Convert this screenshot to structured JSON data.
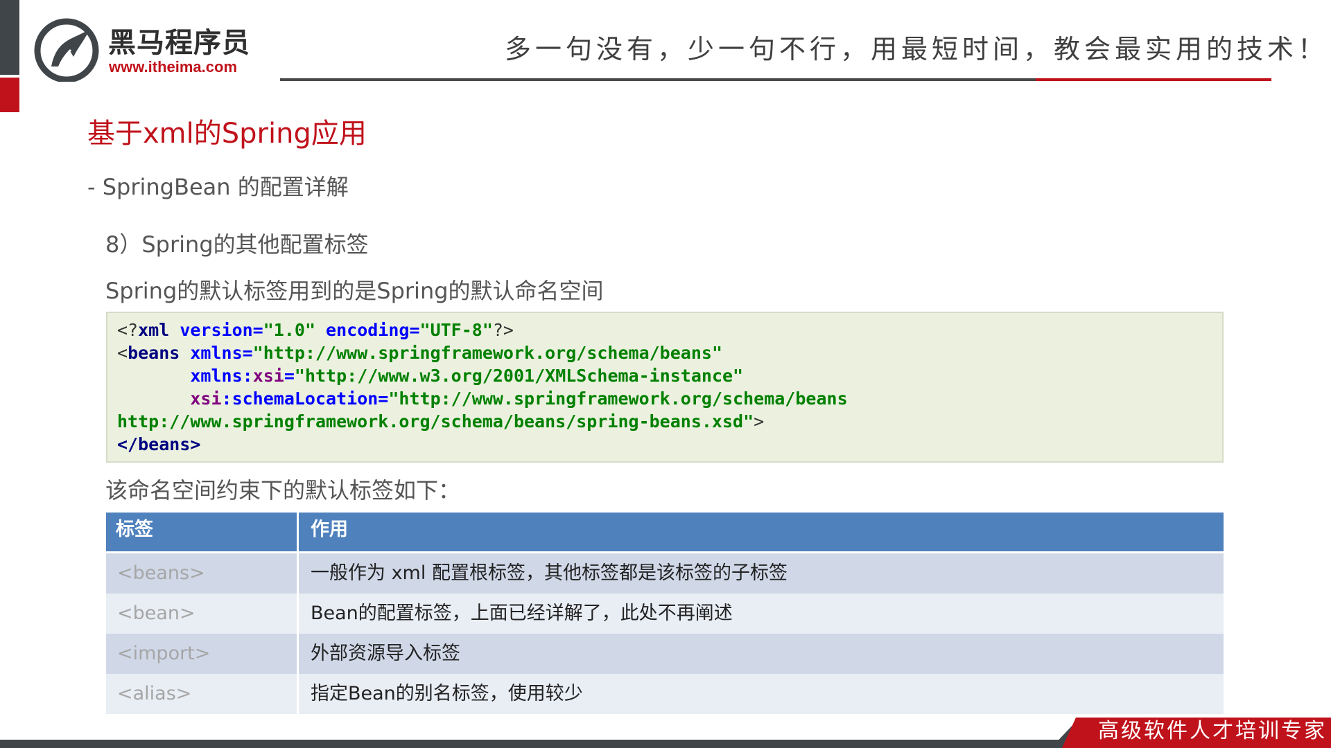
{
  "header": {
    "logo_name": "黑马程序员",
    "logo_url": "www.itheima.com",
    "slogan": "多一句没有，少一句不行，用最短时间，教会最实用的技术！"
  },
  "slide": {
    "title": "基于xml的Spring应用",
    "subtitle": "- SpringBean 的配置详解",
    "section_heading": "8）Spring的其他配置标签",
    "intro_text": "Spring的默认标签用到的是Spring的默认命名空间",
    "code": {
      "line1": {
        "open": "<?",
        "tag": "xml",
        "a1": " version=",
        "v1": "\"1.0\"",
        "a2": " encoding=",
        "v2": "\"UTF-8\"",
        "close": "?>"
      },
      "line2": {
        "open": "<",
        "tag": "beans",
        "attr": " xmlns=",
        "val": "\"http://www.springframework.org/schema/beans\""
      },
      "line3": {
        "indent": "       ",
        "attr": "xmlns",
        "colon": ":",
        "ns": "xsi",
        "eq": "=",
        "val": "\"http://www.w3.org/2001/XMLSchema-instance\""
      },
      "line4": {
        "indent": "       ",
        "ns": "xsi",
        "colon": ":",
        "attr": "schemaLocation=",
        "val": "\"http://www.springframework.org/schema/beans"
      },
      "line5": {
        "val": "http://www.springframework.org/schema/beans/spring-beans.xsd\"",
        "close": ">"
      },
      "line6": {
        "tag": "</beans>"
      }
    },
    "caption": "该命名空间约束下的默认标签如下：",
    "table": {
      "headers": [
        "标签",
        "作用"
      ],
      "rows": [
        {
          "tag": "<beans>",
          "desc": "一般作为 xml 配置根标签，其他标签都是该标签的子标签"
        },
        {
          "tag": "<bean>",
          "desc": "Bean的配置标签，上面已经详解了，此处不再阐述"
        },
        {
          "tag": "<import>",
          "desc": "外部资源导入标签"
        },
        {
          "tag": "<alias>",
          "desc": "指定Bean的别名标签，使用较少"
        }
      ]
    }
  },
  "footer": {
    "tagline": "高级软件人才培训专家"
  },
  "colors": {
    "brand_red": "#c0121b",
    "dark_gray": "#3f4548",
    "table_header": "#4f81bd",
    "code_bg": "#ebf1de"
  }
}
